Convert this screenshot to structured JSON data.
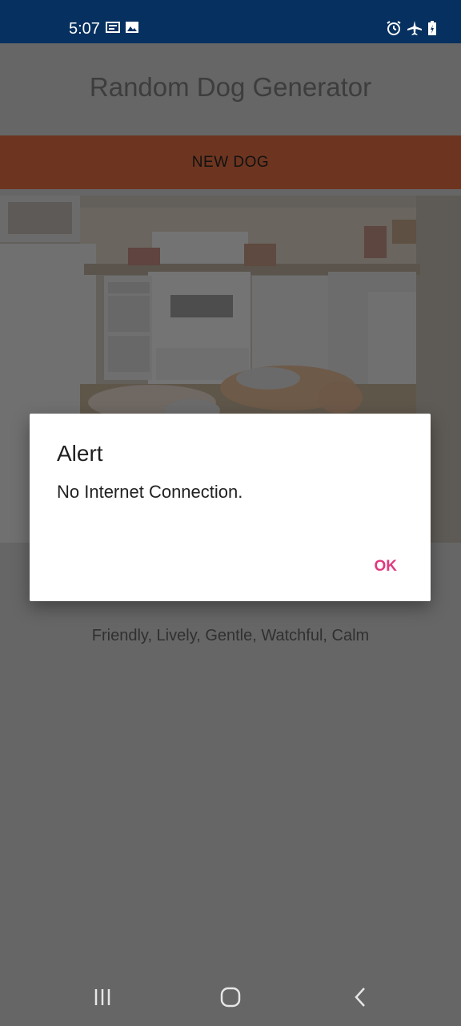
{
  "status_bar": {
    "time": "5:07",
    "left_icons": [
      "notification-card-icon",
      "image-icon"
    ],
    "right_icons": [
      "alarm-icon",
      "airplane-mode-icon",
      "battery-charging-icon"
    ]
  },
  "app": {
    "title": "Random Dog Generator",
    "new_dog_label": "NEW DOG",
    "photo_icon": "dog-photo-kitchen",
    "temperament": "Friendly, Lively, Gentle, Watchful, Calm"
  },
  "alert": {
    "title": "Alert",
    "message": "No Internet Connection.",
    "ok_label": "OK"
  },
  "nav": {
    "icons": [
      "recent-apps-icon",
      "home-icon",
      "back-icon"
    ]
  },
  "colors": {
    "status_bar": "#06305f",
    "button": "#6d3520",
    "accent": "#e0397f",
    "scrim": "#666666"
  }
}
